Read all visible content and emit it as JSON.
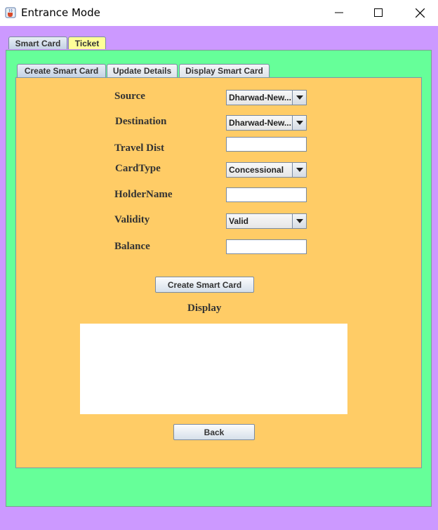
{
  "window": {
    "title": "Entrance Mode"
  },
  "outer_tabs": [
    "Smart Card",
    "Ticket"
  ],
  "inner_tabs": [
    "Create Smart Card",
    "Update Details",
    "Display Smart Card"
  ],
  "form": {
    "source": {
      "label": "Source",
      "value": "Dharwad-New..."
    },
    "destination": {
      "label": "Destination",
      "value": "Dharwad-New..."
    },
    "travel_dist": {
      "label": "Travel Dist",
      "value": ""
    },
    "card_type": {
      "label": "CardType",
      "value": "Concessional"
    },
    "holder_name": {
      "label": "HolderName",
      "value": ""
    },
    "validity": {
      "label": "Validity",
      "value": "Valid"
    },
    "balance": {
      "label": "Balance",
      "value": ""
    }
  },
  "buttons": {
    "create": "Create Smart Card",
    "back": "Back"
  },
  "display": {
    "label": "Display",
    "value": ""
  },
  "colors": {
    "window_bg": "#cc99ff",
    "tab_panel": "#66ff99",
    "form_bg": "#ffcc66",
    "ticket_tab": "#ffff99"
  },
  "icons": {
    "app": "java-cup-icon",
    "minimize": "minimize-icon",
    "maximize": "maximize-icon",
    "close": "close-icon",
    "dropdown": "chevron-down-icon"
  }
}
